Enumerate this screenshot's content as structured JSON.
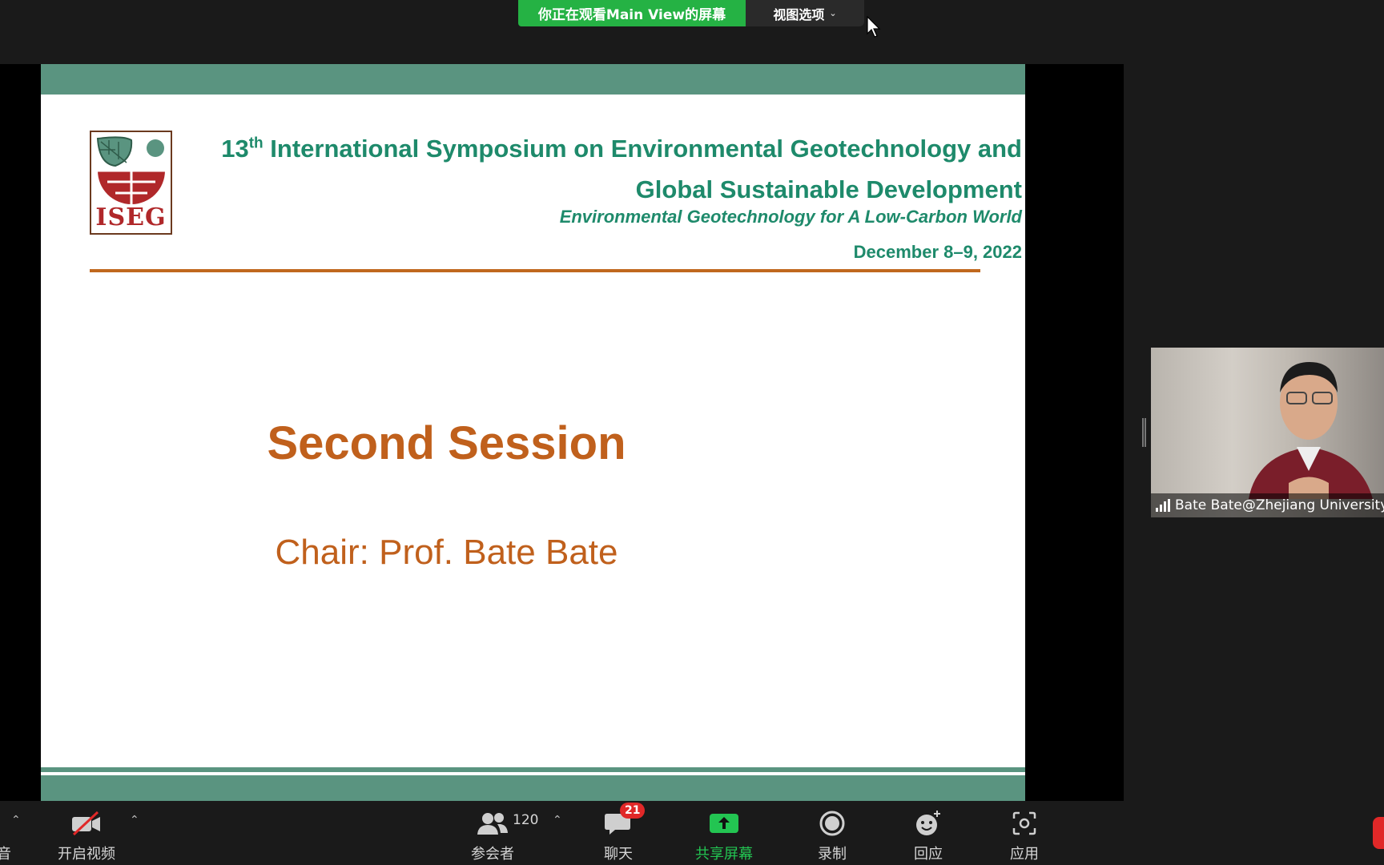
{
  "banner": {
    "viewing_text": "你正在观看Main  View的屏幕",
    "view_options_label": "视图选项"
  },
  "slide": {
    "logo_text": "ISEG",
    "title_number": "13",
    "title_superscript": "th",
    "title_line1_rest": " International Symposium on Environmental Geotechnology and",
    "title_line2": "Global Sustainable Development",
    "subtitle": "Environmental Geotechnology for A Low-Carbon World",
    "date": "December 8–9, 2022",
    "session_title": "Second Session",
    "chair": "Chair: Prof. Bate Bate"
  },
  "video_tile": {
    "participant_name": "Bate Bate@Zhejiang University"
  },
  "toolbar": {
    "audio_label_partial": "音",
    "video_label": "开启视频",
    "participants_label": "参会者",
    "participants_count": "120",
    "chat_label": "聊天",
    "chat_badge": "21",
    "share_label": "共享屏幕",
    "record_label": "录制",
    "reactions_label": "回应",
    "apps_label": "应用"
  },
  "colors": {
    "banner_green": "#25b244",
    "slide_band": "#5a9480",
    "slide_title": "#1e8a6b",
    "slide_orange": "#c0601c",
    "share_green": "#23c552",
    "end_red": "#e02828"
  }
}
